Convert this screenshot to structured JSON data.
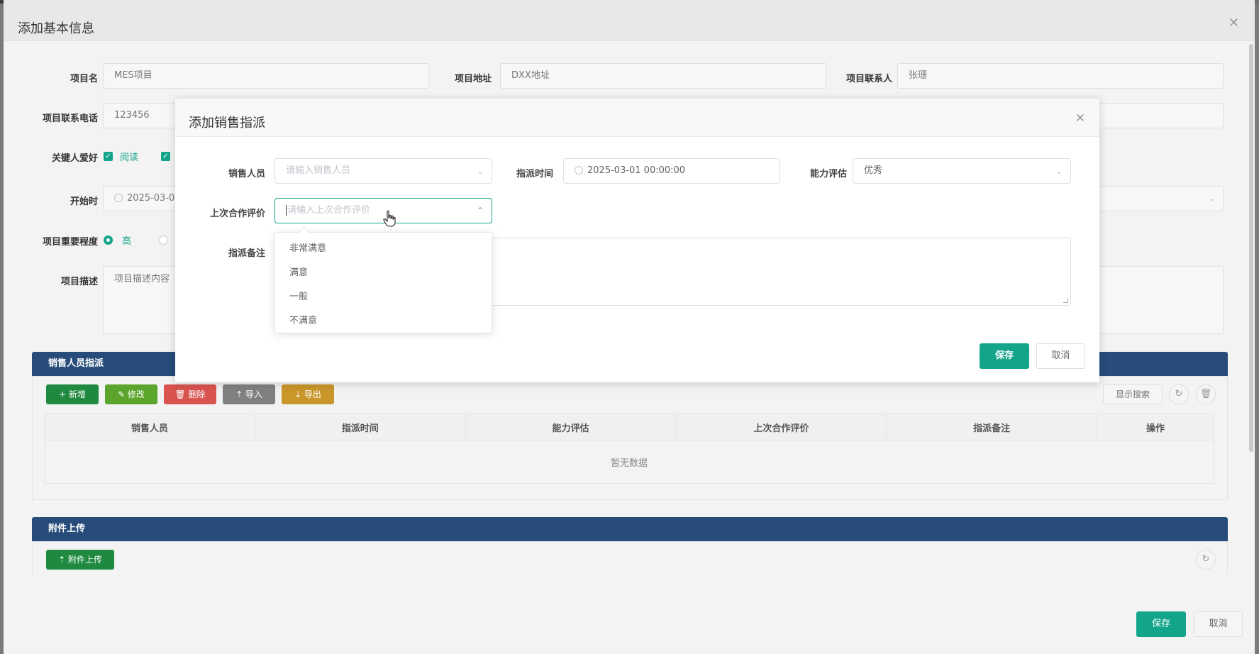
{
  "outer": {
    "title": "添加基本信息",
    "fields": {
      "project_name_label": "项目名",
      "project_name_value": "MES项目",
      "project_address_label": "项目地址",
      "project_address_value": "DXX地址",
      "project_contact_label": "项目联系人",
      "project_contact_value": "张珊",
      "project_phone_label": "项目联系电话",
      "project_phone_value": "123456",
      "key_hobby_label": "关键人爱好",
      "key_hobby_option": "阅读",
      "start_time_label": "开始时",
      "start_time_value": "2025-03-01",
      "importance_label": "项目重要程度",
      "importance_option": "高",
      "description_label": "项目描述",
      "description_value": "项目描述内容"
    },
    "sales_section": {
      "title": "销售人员指派",
      "buttons": {
        "add": "+ 新增",
        "edit": "✎ 修改",
        "delete": "🗑 删除",
        "import": "⇡ 导入",
        "export": "⇣ 导出"
      },
      "show_search": "显示搜索",
      "columns": [
        "销售人员",
        "指派时间",
        "能力评估",
        "上次合作评价",
        "指派备注",
        "操作"
      ],
      "empty_text": "暂无数据"
    },
    "attach_section": {
      "title": "附件上传",
      "upload_button": "⇡ 附件上传"
    },
    "save_button": "保存",
    "cancel_button": "取消"
  },
  "dialog": {
    "title": "添加销售指派",
    "salesperson_label": "销售人员",
    "salesperson_placeholder": "请输入销售人员",
    "assign_time_label": "指派时间",
    "assign_time_value": "2025-03-01 00:00:00",
    "ability_label": "能力评估",
    "ability_value": "优秀",
    "last_eval_label": "上次合作评价",
    "last_eval_placeholder": "请输入上次合作评价",
    "remark_label": "指派备注",
    "dropdown_options": [
      "非常满意",
      "满意",
      "一般",
      "不满意"
    ],
    "save_button": "保存",
    "cancel_button": "取消"
  },
  "colors": {
    "primary": "#12a58a",
    "section_header": "#274c7a",
    "add": "#1f8a3f",
    "edit": "#5ba52c",
    "delete": "#d9534f",
    "import": "#808080",
    "export": "#c9962a"
  }
}
